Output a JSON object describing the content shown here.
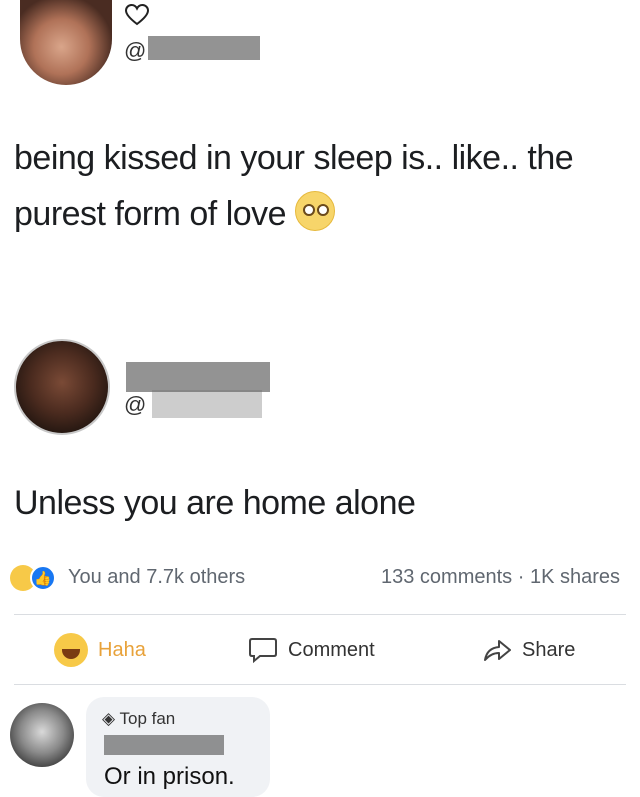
{
  "post": {
    "handle_prefix": "@",
    "text_line1": "being kissed in your sleep is.. like.. the",
    "text_line2": "purest form of love",
    "emoji_icon": "pleading-face-icon"
  },
  "reply": {
    "handle_prefix": "@",
    "text": "Unless you are home alone"
  },
  "stats": {
    "reactions_text": "You and 7.7k others",
    "comments_shares": "133 comments · 1K shares"
  },
  "actions": {
    "haha_label": "Haha",
    "comment_label": "Comment",
    "share_label": "Share"
  },
  "comment": {
    "badge": "Top fan",
    "text": "Or in prison."
  },
  "colors": {
    "like_blue": "#1877f2",
    "haha_yellow": "#f7c948",
    "haha_text": "#e8a23a"
  }
}
